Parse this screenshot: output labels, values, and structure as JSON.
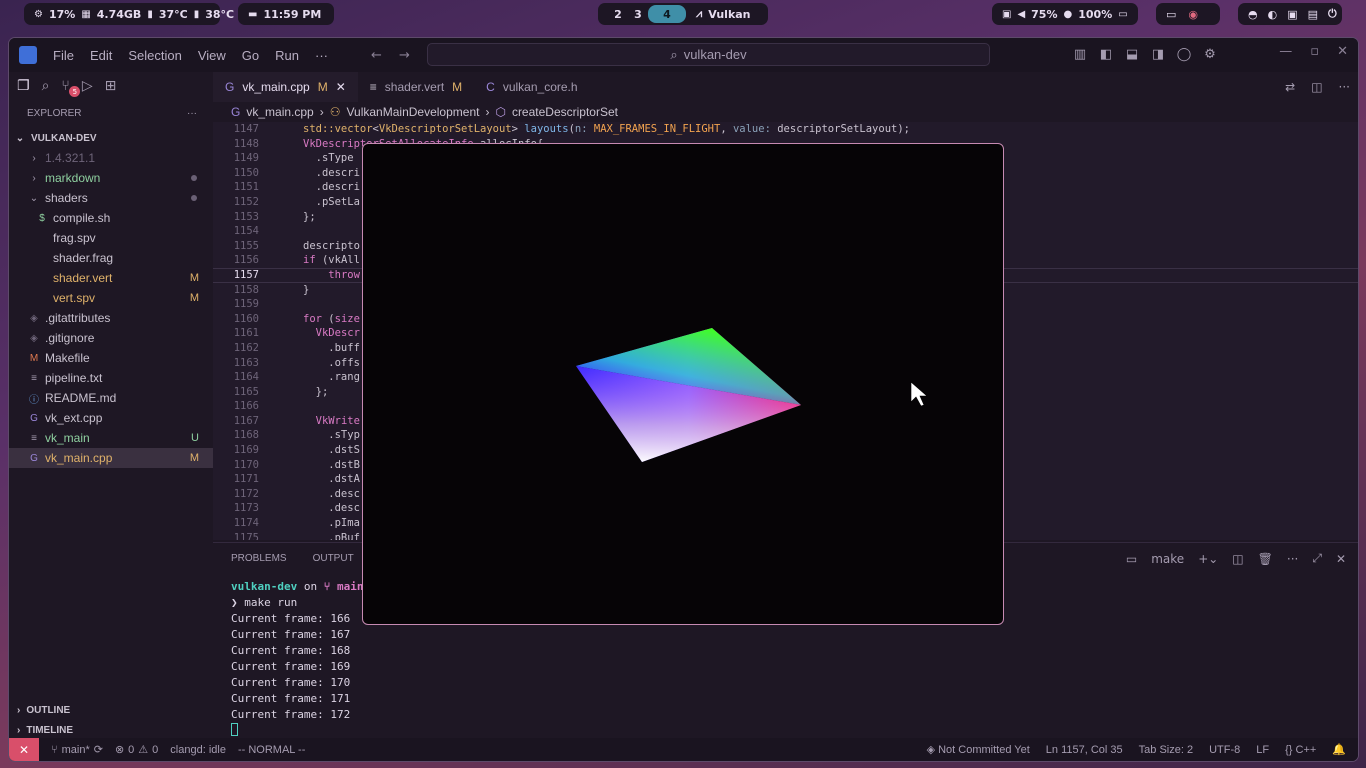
{
  "topbar": {
    "sys": {
      "cpu": "17%",
      "mem": "4.74GB",
      "temp1": "37°C",
      "temp2": "38°C"
    },
    "clock": "11:59 PM",
    "workspaces": [
      "2",
      "3",
      "4"
    ],
    "active_window": "Vulkan",
    "audio": {
      "volume": "75%",
      "battery": "100%"
    }
  },
  "menu": [
    "File",
    "Edit",
    "Selection",
    "View",
    "Go",
    "Run",
    "···"
  ],
  "search": {
    "text": "vulkan-dev"
  },
  "tabs": [
    {
      "label": "vk_main.cpp",
      "status": "M"
    },
    {
      "label": "shader.vert",
      "status": "M"
    },
    {
      "label": "vulkan_core.h",
      "status": ""
    }
  ],
  "breadcrumb": [
    "vk_main.cpp",
    "VulkanMainDevelopment",
    "createDescriptorSet"
  ],
  "explorer": {
    "title": "EXPLORER",
    "root": "VULKAN-DEV",
    "items": [
      {
        "label": "1.4.321.1",
        "kind": "folder",
        "depth": 1,
        "status": "",
        "color": "#6e6479"
      },
      {
        "label": "markdown",
        "kind": "folder",
        "depth": 1,
        "status": "dot",
        "color": "#8fd0a0"
      },
      {
        "label": "shaders",
        "kind": "folder-open",
        "depth": 1,
        "status": "dot",
        "color": "#c9c2cf"
      },
      {
        "label": "compile.sh",
        "kind": "sh",
        "depth": 2,
        "status": "",
        "color": "#c9c2cf"
      },
      {
        "label": "frag.spv",
        "kind": "file",
        "depth": 2,
        "status": "",
        "color": "#c9c2cf"
      },
      {
        "label": "shader.frag",
        "kind": "file",
        "depth": 2,
        "status": "",
        "color": "#c9c2cf"
      },
      {
        "label": "shader.vert",
        "kind": "file",
        "depth": 2,
        "status": "M",
        "color": "#e0b26a"
      },
      {
        "label": "vert.spv",
        "kind": "file",
        "depth": 2,
        "status": "M",
        "color": "#e0b26a"
      },
      {
        "label": ".gitattributes",
        "kind": "git",
        "depth": 1,
        "status": "",
        "color": "#c9c2cf"
      },
      {
        "label": ".gitignore",
        "kind": "git",
        "depth": 1,
        "status": "",
        "color": "#c9c2cf"
      },
      {
        "label": "Makefile",
        "kind": "make",
        "depth": 1,
        "status": "",
        "color": "#c9c2cf"
      },
      {
        "label": "pipeline.txt",
        "kind": "txt",
        "depth": 1,
        "status": "",
        "color": "#c9c2cf"
      },
      {
        "label": "README.md",
        "kind": "info",
        "depth": 1,
        "status": "",
        "color": "#c9c2cf"
      },
      {
        "label": "vk_ext.cpp",
        "kind": "cpp",
        "depth": 1,
        "status": "",
        "color": "#c9c2cf"
      },
      {
        "label": "vk_main",
        "kind": "txt",
        "depth": 1,
        "status": "U",
        "color": "#8fd0a0"
      },
      {
        "label": "vk_main.cpp",
        "kind": "cpp",
        "depth": 1,
        "status": "M",
        "color": "#e0b26a",
        "selected": true
      }
    ]
  },
  "outline": [
    "OUTLINE",
    "TIMELINE"
  ],
  "editor": {
    "lines": [
      "1147",
      "1148",
      "1149",
      "1150",
      "1151",
      "1152",
      "1153",
      "1154",
      "1155",
      "1156",
      "1157",
      "1158",
      "1159",
      "1160",
      "1161",
      "1162",
      "1163",
      "1164",
      "1165",
      "1166",
      "1167",
      "1168",
      "1169",
      "1170",
      "1171",
      "1172",
      "1173",
      "1174",
      "1175"
    ],
    "current_line": "1157"
  },
  "panel": {
    "tabs": [
      "PROBLEMS",
      "OUTPUT"
    ],
    "terminal_name": "make",
    "prompt_dir": "vulkan-dev",
    "prompt_on": "on",
    "prompt_branch": "main",
    "command": "❯ make run",
    "frames": [
      "Current frame: 166",
      "Current frame: 167",
      "Current frame: 168",
      "Current frame: 169",
      "Current frame: 170",
      "Current frame: 171",
      "Current frame: 172"
    ]
  },
  "statusbar": {
    "branch": "main*",
    "errors": "0",
    "warnings": "0",
    "clangd": "clangd: idle",
    "mode": "-- NORMAL --",
    "commit": "Not Committed Yet",
    "position": "Ln 1157, Col 35",
    "tabsize": "Tab Size: 2",
    "encoding": "UTF-8",
    "eol": "LF",
    "language": "C++"
  },
  "colors": {
    "accent": "#3f8fa8",
    "remote": "#d94f6a",
    "window_border": "#c68ab2"
  }
}
